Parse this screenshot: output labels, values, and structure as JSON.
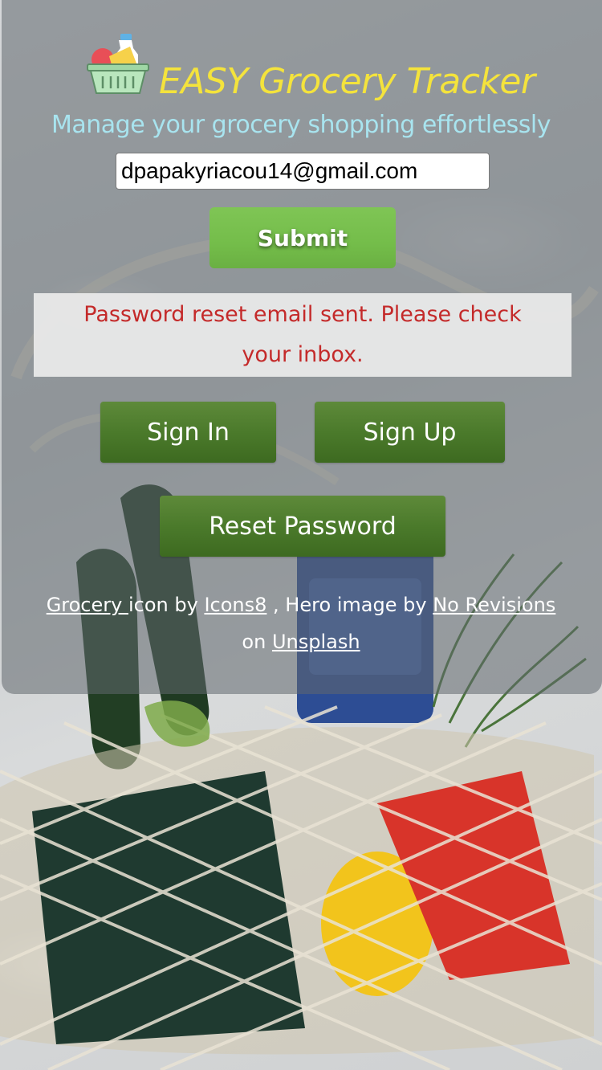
{
  "header": {
    "title": "EASY Grocery Tracker",
    "tagline": "Manage your grocery shopping effortlessly"
  },
  "form": {
    "email_value": "dpapakyriacou14@gmail.com",
    "submit_label": "Submit"
  },
  "status": {
    "message": "Password reset email sent. Please check your inbox."
  },
  "actions": {
    "sign_in_label": "Sign In",
    "sign_up_label": "Sign Up",
    "reset_password_label": "Reset Password"
  },
  "credits": {
    "grocery_link": "Grocery ",
    "icon_by_text": "icon by",
    "icons8_link": "Icons8",
    "hero_text": ", Hero image by",
    "no_revisions_link": "No Revisions",
    "on_text": "on",
    "unsplash_link": "Unsplash"
  },
  "colors": {
    "title": "#f4e33c",
    "tagline": "#a8e4ef",
    "submit": "#7fc555",
    "nav_button": "#4b7a2b",
    "status_text": "#c42a2a"
  }
}
